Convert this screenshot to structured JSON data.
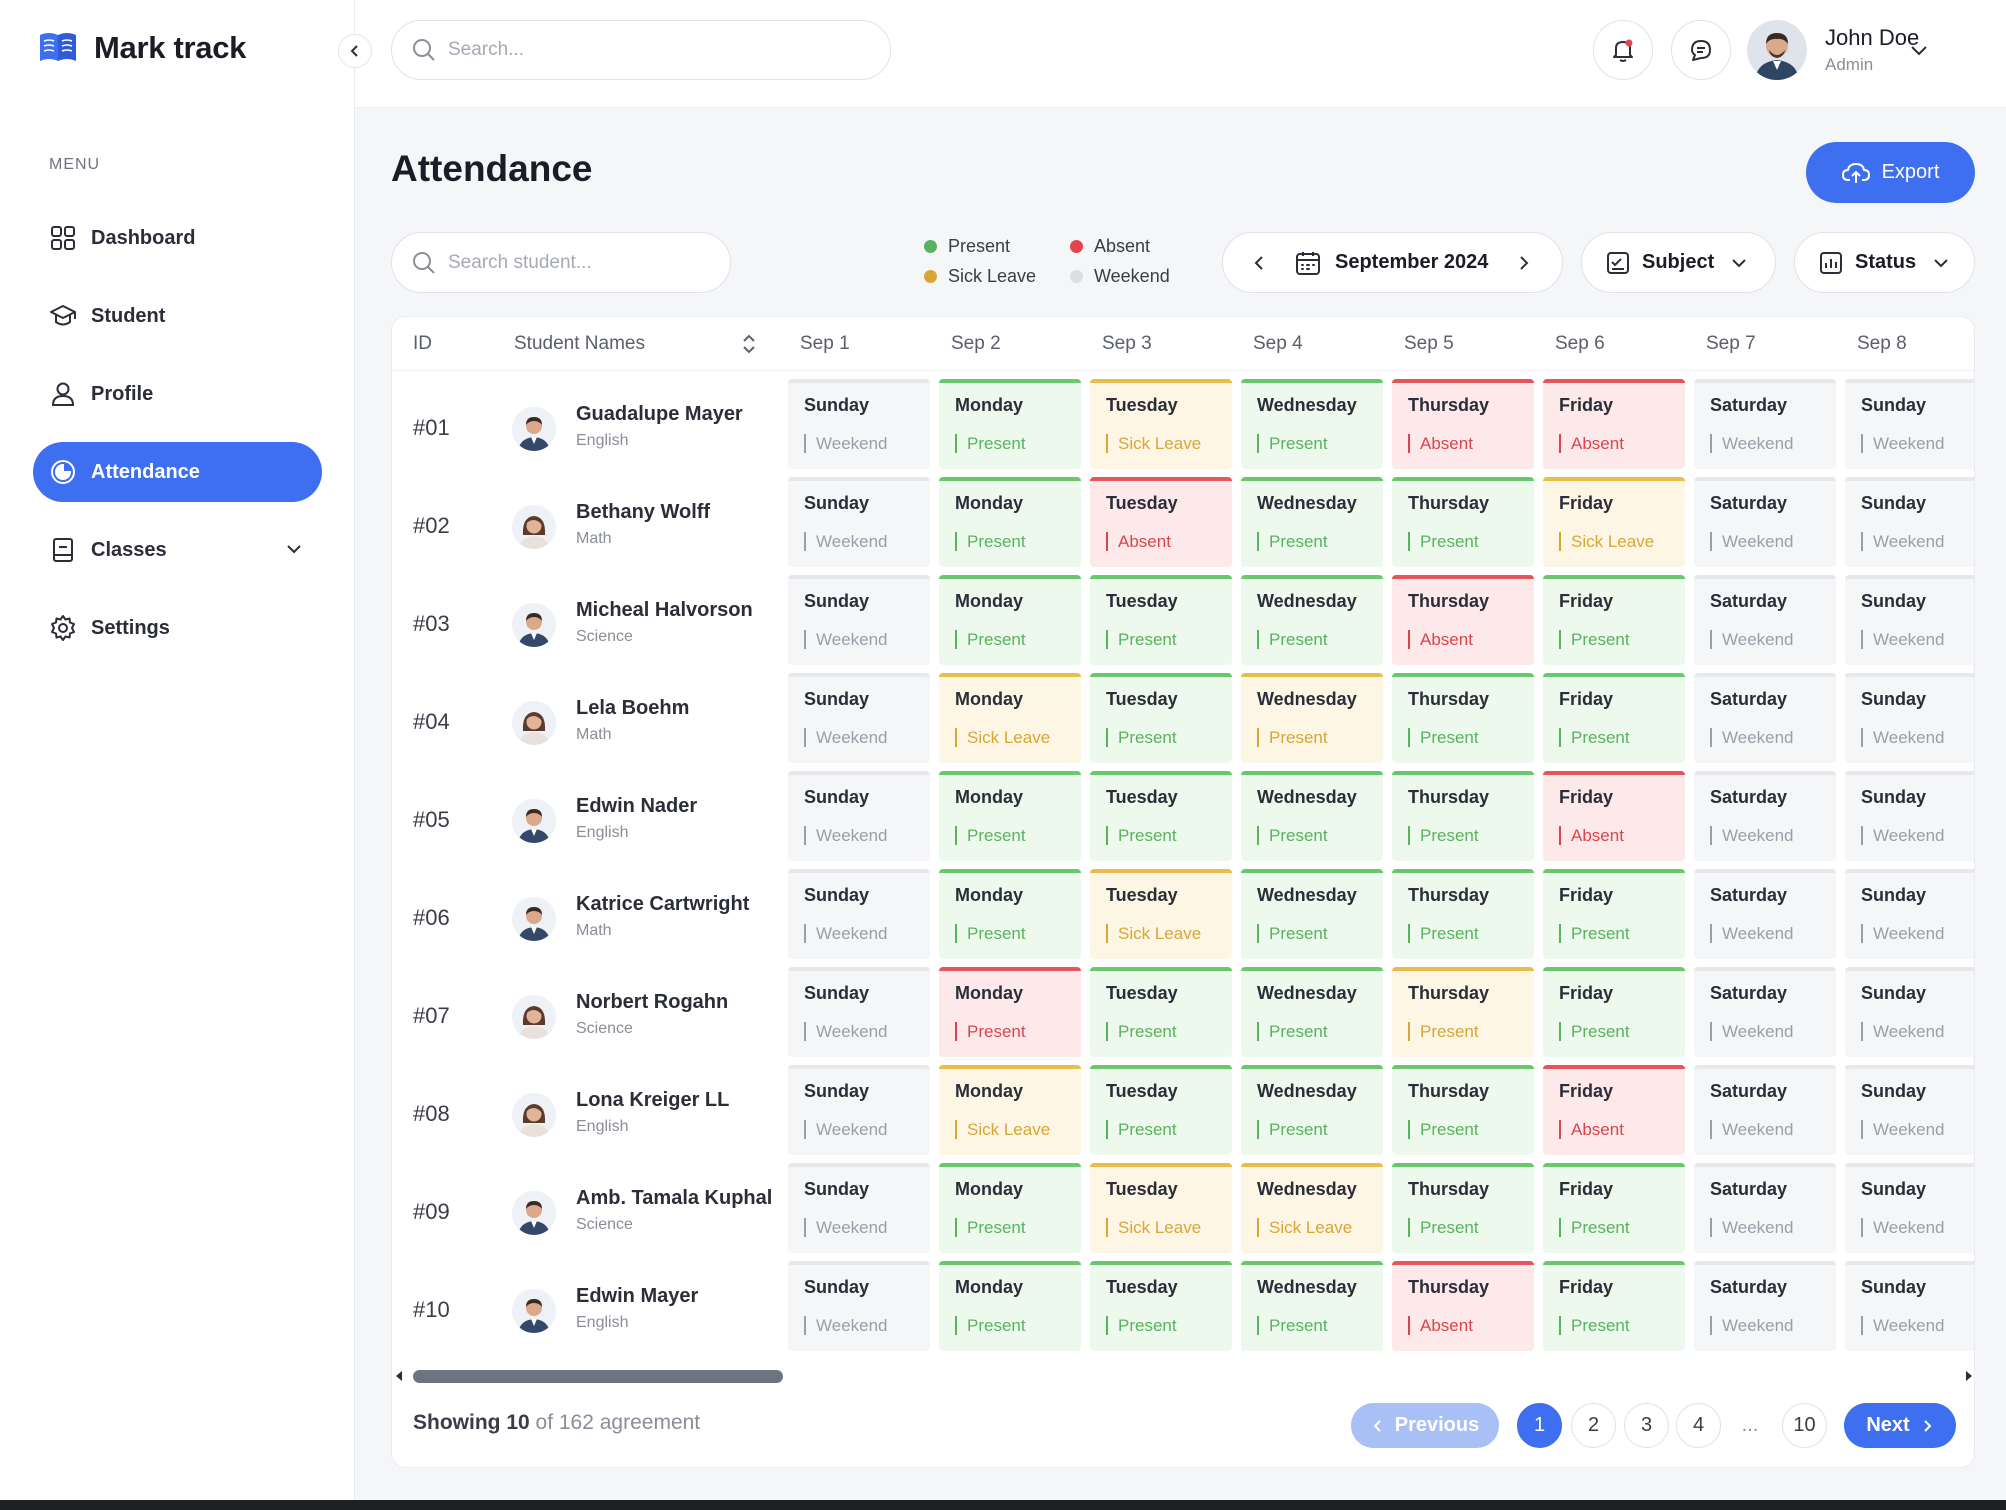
{
  "app": {
    "name": "Mark track"
  },
  "sidebar": {
    "menu_caption": "MENU",
    "items": [
      {
        "label": "Dashboard",
        "icon": "dashboard-grid-icon",
        "active": false
      },
      {
        "label": "Student",
        "icon": "graduation-cap-icon",
        "active": false
      },
      {
        "label": "Profile",
        "icon": "user-icon",
        "active": false
      },
      {
        "label": "Attendance",
        "icon": "attendance-pie-icon",
        "active": true
      },
      {
        "label": "Classes",
        "icon": "book-icon",
        "active": false,
        "has_submenu": true
      },
      {
        "label": "Settings",
        "icon": "gear-icon",
        "active": false
      }
    ]
  },
  "topbar": {
    "search_placeholder": "Search...",
    "user": {
      "name": "John Doe",
      "role": "Admin"
    }
  },
  "page": {
    "title": "Attendance",
    "export_label": "Export",
    "student_search_placeholder": "Search student...",
    "legend": [
      {
        "label": "Present",
        "color": "#5ab25e"
      },
      {
        "label": "Absent",
        "color": "#e2454c"
      },
      {
        "label": "Sick Leave",
        "color": "#d8a637"
      },
      {
        "label": "Weekend",
        "color": "#dcdee3"
      }
    ],
    "month": "September 2024",
    "subject_filter": "Subject",
    "status_filter": "Status"
  },
  "table": {
    "headers": {
      "id": "ID",
      "name": "Student Names"
    },
    "dates": [
      "Sep 1",
      "Sep 2",
      "Sep 3",
      "Sep 4",
      "Sep 5",
      "Sep 6",
      "Sep 7",
      "Sep 8"
    ],
    "days": [
      "Sunday",
      "Monday",
      "Tuesday",
      "Wednesday",
      "Thursday",
      "Friday",
      "Saturday",
      "Sunday"
    ],
    "rows": [
      {
        "id": "#01",
        "name": "Guadalupe Mayer",
        "subject": "English",
        "gender": "m",
        "cells": [
          [
            "weekend",
            "Weekend"
          ],
          [
            "present",
            "Present"
          ],
          [
            "sick",
            "Sick Leave"
          ],
          [
            "present",
            "Present"
          ],
          [
            "absent",
            "Absent"
          ],
          [
            "absent",
            "Absent"
          ],
          [
            "weekend",
            "Weekend"
          ],
          [
            "weekend",
            "Weekend"
          ]
        ]
      },
      {
        "id": "#02",
        "name": "Bethany Wolff",
        "subject": "Math",
        "gender": "f",
        "cells": [
          [
            "weekend",
            "Weekend"
          ],
          [
            "present",
            "Present"
          ],
          [
            "absent",
            "Absent"
          ],
          [
            "present",
            "Present"
          ],
          [
            "present",
            "Present"
          ],
          [
            "sick",
            "Sick Leave"
          ],
          [
            "weekend",
            "Weekend"
          ],
          [
            "weekend",
            "Weekend"
          ]
        ]
      },
      {
        "id": "#03",
        "name": "Micheal Halvorson",
        "subject": "Science",
        "gender": "m",
        "cells": [
          [
            "weekend",
            "Weekend"
          ],
          [
            "present",
            "Present"
          ],
          [
            "present",
            "Present"
          ],
          [
            "present",
            "Present"
          ],
          [
            "absent",
            "Absent"
          ],
          [
            "present",
            "Present"
          ],
          [
            "weekend",
            "Weekend"
          ],
          [
            "weekend",
            "Weekend"
          ]
        ]
      },
      {
        "id": "#04",
        "name": "Lela Boehm",
        "subject": "Math",
        "gender": "f",
        "cells": [
          [
            "weekend",
            "Weekend"
          ],
          [
            "sick",
            "Sick Leave"
          ],
          [
            "present",
            "Present"
          ],
          [
            "sick",
            "Present"
          ],
          [
            "present",
            "Present"
          ],
          [
            "present",
            "Present"
          ],
          [
            "weekend",
            "Weekend"
          ],
          [
            "weekend",
            "Weekend"
          ]
        ]
      },
      {
        "id": "#05",
        "name": "Edwin Nader",
        "subject": "English",
        "gender": "m",
        "cells": [
          [
            "weekend",
            "Weekend"
          ],
          [
            "present",
            "Present"
          ],
          [
            "present",
            "Present"
          ],
          [
            "present",
            "Present"
          ],
          [
            "present",
            "Present"
          ],
          [
            "absent",
            "Absent"
          ],
          [
            "weekend",
            "Weekend"
          ],
          [
            "weekend",
            "Weekend"
          ]
        ]
      },
      {
        "id": "#06",
        "name": "Katrice Cartwright",
        "subject": "Math",
        "gender": "m",
        "cells": [
          [
            "weekend",
            "Weekend"
          ],
          [
            "present",
            "Present"
          ],
          [
            "sick",
            "Sick Leave"
          ],
          [
            "present",
            "Present"
          ],
          [
            "present",
            "Present"
          ],
          [
            "present",
            "Present"
          ],
          [
            "weekend",
            "Weekend"
          ],
          [
            "weekend",
            "Weekend"
          ]
        ]
      },
      {
        "id": "#07",
        "name": "Norbert Rogahn",
        "subject": "Science",
        "gender": "f",
        "cells": [
          [
            "weekend",
            "Weekend"
          ],
          [
            "absent",
            "Present"
          ],
          [
            "present",
            "Present"
          ],
          [
            "present",
            "Present"
          ],
          [
            "sick",
            "Present"
          ],
          [
            "present",
            "Present"
          ],
          [
            "weekend",
            "Weekend"
          ],
          [
            "weekend",
            "Weekend"
          ]
        ]
      },
      {
        "id": "#08",
        "name": "Lona Kreiger LL",
        "subject": "English",
        "gender": "f",
        "cells": [
          [
            "weekend",
            "Weekend"
          ],
          [
            "sick",
            "Sick Leave"
          ],
          [
            "present",
            "Present"
          ],
          [
            "present",
            "Present"
          ],
          [
            "present",
            "Present"
          ],
          [
            "absent",
            "Absent"
          ],
          [
            "weekend",
            "Weekend"
          ],
          [
            "weekend",
            "Weekend"
          ]
        ]
      },
      {
        "id": "#09",
        "name": "Amb. Tamala Kuphal",
        "subject": "Science",
        "gender": "m",
        "cells": [
          [
            "weekend",
            "Weekend"
          ],
          [
            "present",
            "Present"
          ],
          [
            "sick",
            "Sick Leave"
          ],
          [
            "sick",
            "Sick Leave"
          ],
          [
            "present",
            "Present"
          ],
          [
            "present",
            "Present"
          ],
          [
            "weekend",
            "Weekend"
          ],
          [
            "weekend",
            "Weekend"
          ]
        ]
      },
      {
        "id": "#10",
        "name": "Edwin Mayer",
        "subject": "English",
        "gender": "m",
        "cells": [
          [
            "weekend",
            "Weekend"
          ],
          [
            "present",
            "Present"
          ],
          [
            "present",
            "Present"
          ],
          [
            "present",
            "Present"
          ],
          [
            "absent",
            "Absent"
          ],
          [
            "present",
            "Present"
          ],
          [
            "weekend",
            "Weekend"
          ],
          [
            "weekend",
            "Weekend"
          ]
        ]
      }
    ]
  },
  "footer": {
    "showing_count": "Showing 10",
    "showing_rest": " of 162 agreement",
    "prev_label": "Previous",
    "next_label": "Next",
    "pages": [
      "1",
      "2",
      "3",
      "4",
      "...",
      "10"
    ],
    "current_page": "1"
  }
}
